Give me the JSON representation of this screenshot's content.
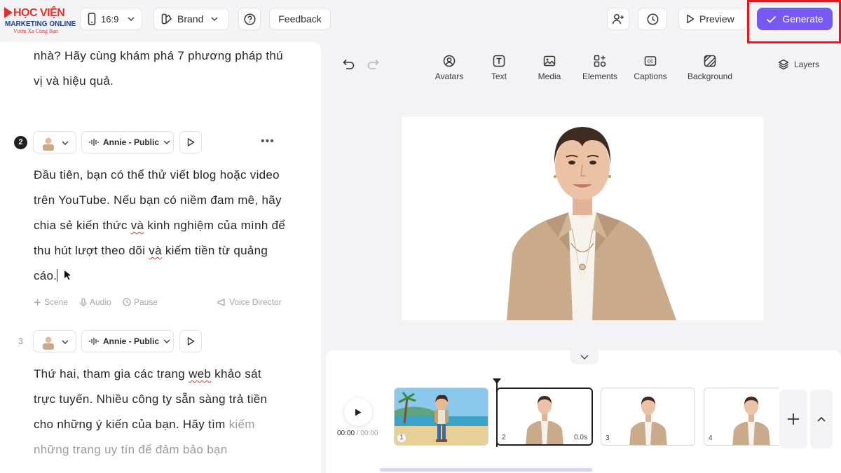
{
  "logo": {
    "line1": "HỌC VIỆN",
    "line2": "MARKETING ONLINE",
    "line3": "Vươn Xa Cùng Bạn"
  },
  "topbar": {
    "ratio_label": "16:9",
    "brand_label": "Brand",
    "feedback_label": "Feedback",
    "preview_label": "Preview",
    "generate_label": "Generate"
  },
  "script": {
    "intro_text": "nhà? Hãy cùng khám phá 7 phương pháp thú vị và hiệu quả.",
    "scenes": [
      {
        "number": "2",
        "voice": "Annie - Public",
        "text_a": "Đầu tiên, bạn có thể thử viết blog hoặc video trên YouTube. Nếu bạn có niềm đam mê, hãy chia sẻ kiến thức ",
        "text_b": "và",
        "text_c": " kinh nghiệm của mình để thu hút lượt theo dõi ",
        "text_d": "và",
        "text_e": " kiếm tiền từ quảng cáo."
      },
      {
        "number": "3",
        "voice": "Annie - Public",
        "text_a": "Thứ hai, tham gia các trang ",
        "text_b": "web",
        "text_c": " khảo sát trực tuyến. Nhiều công ty sẵn sàng trả tiền cho những ý kiến của bạn. Hãy tìm ",
        "text_fade": "kiếm những trang uy tín để đảm bảo bạn"
      }
    ],
    "actions": {
      "scene": "Scene",
      "audio": "Audio",
      "pause": "Pause",
      "voice_director": "Voice Director"
    }
  },
  "toolbar": {
    "tools": [
      "Avatars",
      "Text",
      "Media",
      "Elements",
      "Captions",
      "Background"
    ],
    "layers_label": "Layers"
  },
  "timeline": {
    "time_current": "00:00",
    "time_sep": " / ",
    "time_total": "00:00",
    "clips": [
      {
        "index": "1",
        "duration": ""
      },
      {
        "index": "2",
        "duration": "0.0s"
      },
      {
        "index": "3",
        "duration": ""
      },
      {
        "index": "4",
        "duration": ""
      }
    ]
  },
  "colors": {
    "accent": "#7559f2",
    "highlight": "#e8151c",
    "logo_red": "#e0312a",
    "logo_blue": "#1c3f94"
  }
}
